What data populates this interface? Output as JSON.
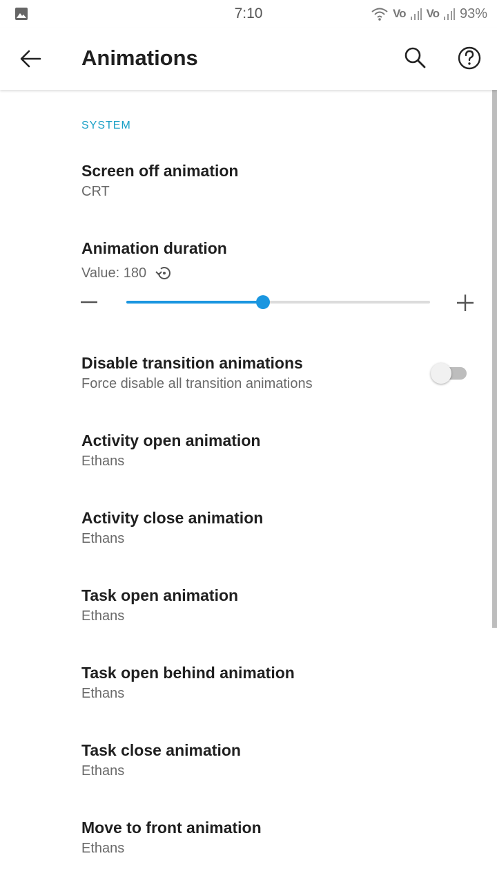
{
  "status_bar": {
    "time": "7:10",
    "network_1": "Vo",
    "network_2": "Vo",
    "battery": "93%"
  },
  "app_bar": {
    "title": "Animations"
  },
  "section": {
    "header": "SYSTEM"
  },
  "prefs": {
    "screen_off": {
      "title": "Screen off animation",
      "summary": "CRT"
    },
    "duration": {
      "title": "Animation duration",
      "value_label": "Value: 180",
      "slider_fraction": 0.45
    },
    "disable_transitions": {
      "title": "Disable transition animations",
      "summary": "Force disable all transition animations",
      "enabled": false
    },
    "activity_open": {
      "title": "Activity open animation",
      "summary": "Ethans"
    },
    "activity_close": {
      "title": "Activity close animation",
      "summary": "Ethans"
    },
    "task_open": {
      "title": "Task open animation",
      "summary": "Ethans"
    },
    "task_open_behind": {
      "title": "Task open behind animation",
      "summary": "Ethans"
    },
    "task_close": {
      "title": "Task close animation",
      "summary": "Ethans"
    },
    "move_to_front": {
      "title": "Move to front animation",
      "summary": "Ethans"
    }
  },
  "colors": {
    "accent": "#1a96e0",
    "section_header": "#1aa0c6"
  },
  "icons": {
    "back": "arrow-left-icon",
    "search": "search-icon",
    "help": "help-icon",
    "reset": "restore-icon",
    "minus": "minus-icon",
    "plus": "plus-icon"
  }
}
